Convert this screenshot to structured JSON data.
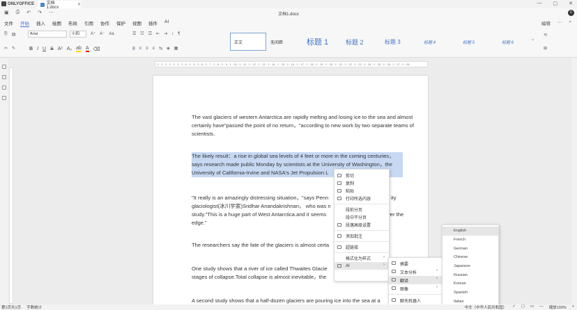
{
  "titlebar": {
    "app": "ONLYOFFICE",
    "doc_tab": "文档1.docx",
    "min": "—",
    "max": "▢",
    "close": "✕"
  },
  "quickbar": {
    "doc_title": "文档1.docx",
    "avatar": "C"
  },
  "menu": {
    "items": [
      "文件",
      "开始",
      "插入",
      "绘图",
      "布局",
      "引用",
      "协作",
      "保护",
      "视图",
      "插件",
      "AI"
    ],
    "active": "开始",
    "right": [
      "编辑",
      "⋯",
      "⌕"
    ]
  },
  "ribbon": {
    "font": "Arial",
    "size": "小四",
    "styles": [
      "正文",
      "无间距",
      "标题 1",
      "标题 2",
      "标题 3",
      "标题 4",
      "标题 5",
      "标题 6"
    ]
  },
  "ruler": "· 1 · 2 · 1 · 2 · 1 · 3 · 1 · 4 · 1 · 5 · 1 · 6 · 1 · 7 · 1 · 8 · 1 · 9 · 1 · 10 · 1 · 11 · 1 · 12 · 1 · 13 · 1 · 14 · 1 · 15 · 1 · 16 · 1 · 17 · 1 · 18 · 1 · 19 · 1 · 20 · 1 · 21 · 1 · 22 · 1 · 23 · 1 · 24 · 1 · 25 · 1 · 26 · 1 · 27 · 1 · 28",
  "doc": {
    "p1": "The vast glaciers of western Antarctica are rapidly melting and losing ice to the sea and almost certainly have\"passed the point of no return，\"according to new work by two separate teams of scientists.",
    "p2": "The likely result：a rise in global sea levels of 4 feet or more in the coming centuries， says research made public Monday by scientists at the University of Washington，the University of California-Irvine and NASA's Jet Propulsion L",
    "p3a": "\"It really is an amazingly distressing situation，\"says Penn",
    "p3b": "ity",
    "p3c": "glaciologist(冰川学家)Sridhar Anandakrishnan， who was n",
    "p3d": "study.\"This is a huge part of West Antarctica.and it seems",
    "p3e": "ver the",
    "p3f": "edge.\"",
    "p4": "The researchers say the fate of the glaciers is almost certa",
    "p5a": "One study shows that a river of ice called Thwaites Glacie",
    "p5b": "stages of collapse.Total collapse is almost inevitable，the",
    "p6": "A second study shows that a half-dozen glaciers are pouring ice into the sea at a"
  },
  "context_menu": {
    "items": [
      "剪切",
      "复制",
      "粘贴",
      "打印所选内容",
      "段前分页",
      "段中不分页",
      "段落高级设置",
      "添加批注",
      "超链接",
      "格式化为样式",
      "AI"
    ]
  },
  "ai_submenu": {
    "items": [
      "摘要",
      "文本分析",
      "翻译",
      "图像",
      "聊天机器人"
    ]
  },
  "languages": [
    "English",
    "French",
    "German",
    "Chinese",
    "Japanese",
    "Russian",
    "Korean",
    "Spanish",
    "Italian"
  ],
  "status": {
    "page": "第1页共1页",
    "wordcount": "字数统计",
    "lang": "中文（中华人民共和国）",
    "zoom": "缩放100%"
  }
}
